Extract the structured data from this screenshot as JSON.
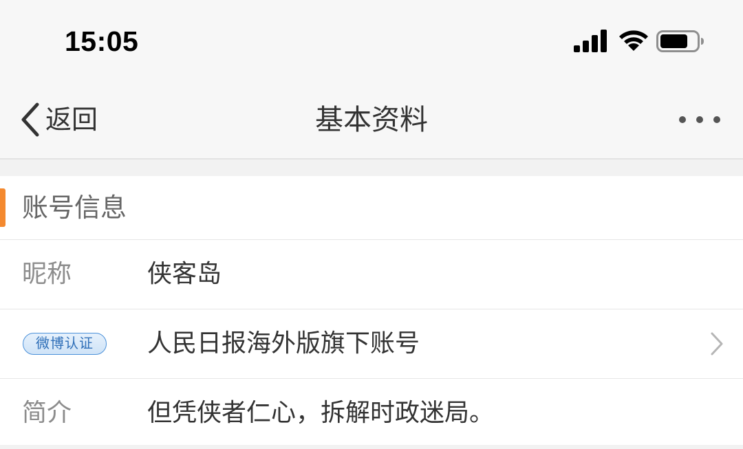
{
  "status_bar": {
    "time": "15:05"
  },
  "nav": {
    "back_label": "返回",
    "title": "基本资料"
  },
  "section": {
    "title": "账号信息"
  },
  "rows": [
    {
      "label": "昵称",
      "value": "侠客岛"
    },
    {
      "badge": "微博认证",
      "value": "人民日报海外版旗下账号"
    },
    {
      "label": "简介",
      "value": "但凭侠者仁心，拆解时政迷局。"
    }
  ],
  "colors": {
    "accent": "#f4892f",
    "badge_blue": "#4a90d9"
  },
  "icons": [
    "signal-icon",
    "wifi-icon",
    "battery-icon",
    "chevron-left-icon",
    "more-icon",
    "chevron-right-icon"
  ]
}
